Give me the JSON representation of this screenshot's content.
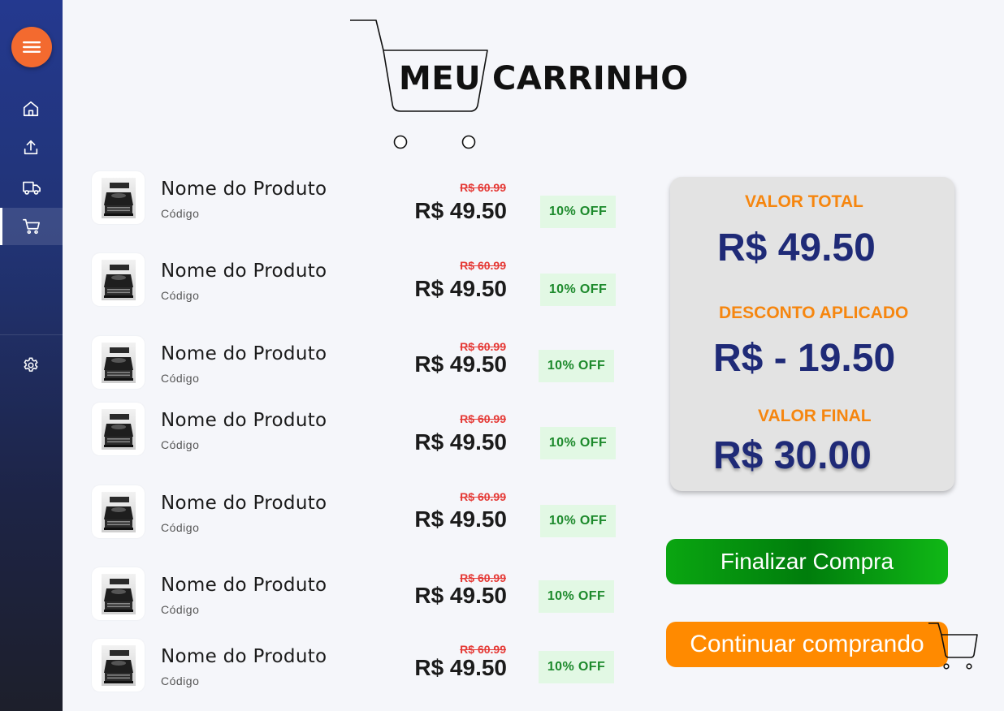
{
  "colors": {
    "sidebar_top": "#24398f",
    "sidebar_bottom": "#1d1f2b",
    "menu_button": "#f36a2f",
    "price_old": "#e53935",
    "badge_bg": "#e2f8e4",
    "badge_text": "#1d8a2c",
    "summary_label": "#f6860f",
    "summary_value": "#1f2a77",
    "finish_button": "#0aa611",
    "continue_button": "#ff8a00"
  },
  "sidebar": {
    "menu_icon": "hamburger-icon",
    "items": [
      {
        "icon": "home-icon",
        "active": false
      },
      {
        "icon": "upload-icon",
        "active": false
      },
      {
        "icon": "truck-icon",
        "active": false
      },
      {
        "icon": "cart-icon",
        "active": true
      }
    ],
    "settings_icon": "gear-icon"
  },
  "header": {
    "title_part1": "MEU",
    "title_part2": "CARRINHO"
  },
  "products": [
    {
      "name": "Nome do Produto",
      "code": "Código",
      "old_price": "R$ 60.99",
      "price": "R$ 49.50",
      "discount": "10% OFF"
    },
    {
      "name": "Nome do Produto",
      "code": "Código",
      "old_price": "R$ 60.99",
      "price": "R$ 49.50",
      "discount": "10% OFF"
    },
    {
      "name": "Nome do Produto",
      "code": "Código",
      "old_price": "R$ 60.99",
      "price": "R$ 49.50",
      "discount": "10% OFF"
    },
    {
      "name": "Nome do Produto",
      "code": "Código",
      "old_price": "R$ 60.99",
      "price": "R$ 49.50",
      "discount": "10% OFF"
    },
    {
      "name": "Nome do Produto",
      "code": "Código",
      "old_price": "R$ 60.99",
      "price": "R$ 49.50",
      "discount": "10% OFF"
    },
    {
      "name": "Nome do Produto",
      "code": "Código",
      "old_price": "R$ 60.99",
      "price": "R$ 49.50",
      "discount": "10% OFF"
    },
    {
      "name": "Nome do Produto",
      "code": "Código",
      "old_price": "R$ 60.99",
      "price": "R$ 49.50",
      "discount": "10% OFF"
    }
  ],
  "summary": {
    "total_label": "VALOR TOTAL",
    "total_value": "R$ 49.50",
    "discount_label": "DESCONTO APLICADO",
    "discount_value": "R$ - 19.50",
    "final_label": "VALOR FINAL",
    "final_value": "R$ 30.00"
  },
  "actions": {
    "finish_label": "Finalizar Compra",
    "continue_label": "Continuar comprando"
  }
}
